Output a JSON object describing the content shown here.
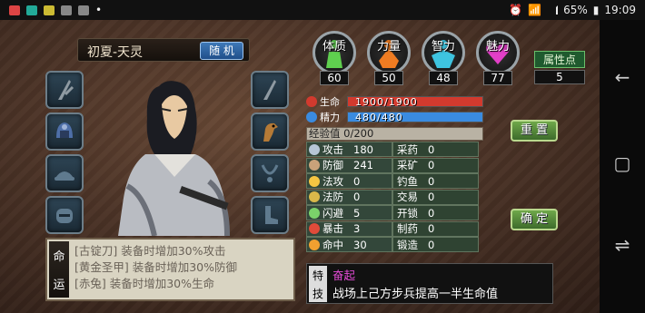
{
  "status_bar": {
    "battery": "65%",
    "time": "19:09"
  },
  "character": {
    "name": "初夏-天灵",
    "random_button": "随 机"
  },
  "attributes": [
    {
      "label": "体质",
      "value": "60",
      "color": "#5fd04f"
    },
    {
      "label": "力量",
      "value": "50",
      "color": "#ef7c22"
    },
    {
      "label": "智力",
      "value": "48",
      "color": "#3ec4e0"
    },
    {
      "label": "魅力",
      "value": "77",
      "color": "#e23fc8"
    }
  ],
  "attribute_points": {
    "label": "属性点",
    "value": "5"
  },
  "bars": {
    "hp": {
      "label": "生命",
      "text": "1900/1900",
      "fraction": 1.0,
      "color": "#d23a2e"
    },
    "mp": {
      "label": "精力",
      "text": "480/480",
      "fraction": 1.0,
      "color": "#3a8be0"
    }
  },
  "experience": {
    "text": "经验值 0/200"
  },
  "stats_left": [
    {
      "name": "攻击",
      "value": "180",
      "color": "#b7c6d6"
    },
    {
      "name": "防御",
      "value": "241",
      "color": "#c9a27a"
    },
    {
      "name": "法攻",
      "value": "0",
      "color": "#f5c542"
    },
    {
      "name": "法防",
      "value": "0",
      "color": "#d9b84a"
    },
    {
      "name": "闪避",
      "value": "5",
      "color": "#7bd36a"
    },
    {
      "name": "暴击",
      "value": "3",
      "color": "#e04b3a"
    },
    {
      "name": "命中",
      "value": "30",
      "color": "#f0a030"
    }
  ],
  "stats_right": [
    {
      "name": "采药",
      "value": "0"
    },
    {
      "name": "采矿",
      "value": "0"
    },
    {
      "name": "钓鱼",
      "value": "0"
    },
    {
      "name": "交易",
      "value": "0"
    },
    {
      "name": "开锁",
      "value": "0"
    },
    {
      "name": "制药",
      "value": "0"
    },
    {
      "name": "锻造",
      "value": "0"
    }
  ],
  "buttons": {
    "reset": "重 置",
    "confirm": "确 定"
  },
  "destiny": {
    "tag": [
      "命",
      "运"
    ],
    "lines": [
      "[古锭刀] 装备时增加30%攻击",
      "[黄金圣甲] 装备时增加30%防御",
      "[赤兔] 装备时增加30%生命"
    ]
  },
  "skill": {
    "tag": [
      "特",
      "技"
    ],
    "name": "奋起",
    "description": "战场上己方步兵提高一半生命值"
  }
}
